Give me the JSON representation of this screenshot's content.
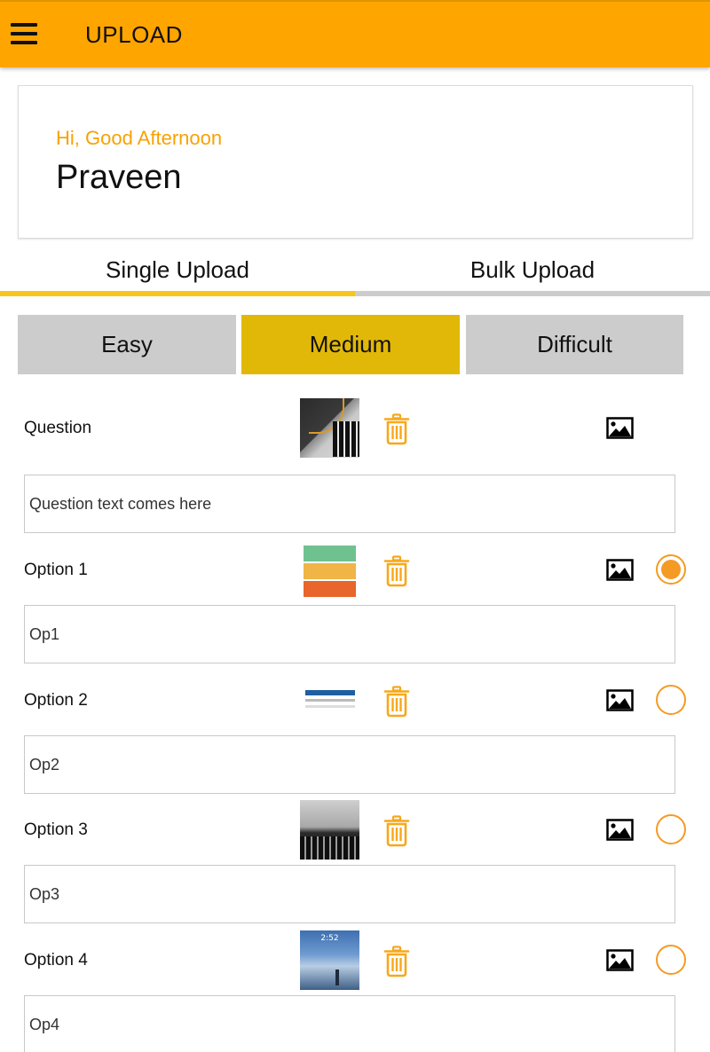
{
  "appbar": {
    "title": "UPLOAD",
    "menu_icon": "hamburger-menu-icon",
    "color": "#FFA500"
  },
  "greeting": {
    "line": "Hi, Good Afternoon",
    "user_name": "Praveen"
  },
  "tabs": [
    {
      "label": "Single Upload",
      "active": true
    },
    {
      "label": "Bulk Upload",
      "active": false
    }
  ],
  "difficulty": {
    "options": [
      "Easy",
      "Medium",
      "Difficult"
    ],
    "selected": "Medium"
  },
  "question": {
    "label": "Question",
    "text": "Question text comes here"
  },
  "options": [
    {
      "label": "Option 1",
      "text": "Op1",
      "correct": true
    },
    {
      "label": "Option 2",
      "text": "Op2",
      "correct": false
    },
    {
      "label": "Option 3",
      "text": "Op3",
      "correct": false
    },
    {
      "label": "Option 4",
      "text": "Op4",
      "correct": false
    }
  ],
  "thumbnails": {
    "option4_clock": "2:52"
  },
  "colors": {
    "accent": "#F9A100",
    "selected_difficulty": "#E2B808",
    "tab_indicator": "#F9C51A",
    "radio": "#F59A23"
  }
}
